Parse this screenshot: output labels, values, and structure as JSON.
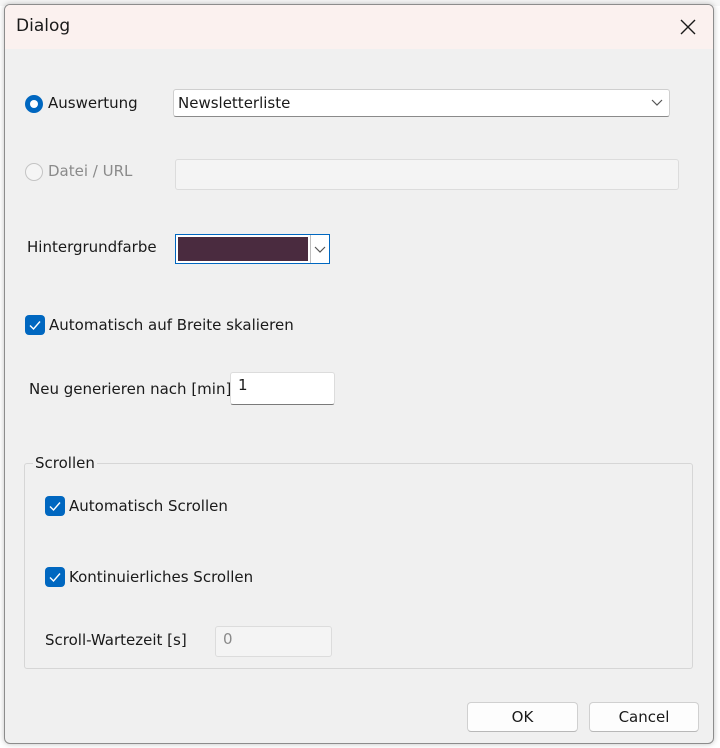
{
  "dialog": {
    "title": "Dialog"
  },
  "source": {
    "evaluation_label": "Auswertung",
    "evaluation_selected": true,
    "evaluation_value": "Newsletterliste",
    "file_label": "Datei / URL",
    "file_selected": false,
    "file_value": ""
  },
  "background": {
    "label": "Hintergrundfarbe",
    "color": "#4a2b3f"
  },
  "scale": {
    "label": "Automatisch auf Breite skalieren",
    "checked": true
  },
  "regenerate": {
    "label": "Neu generieren nach [min]",
    "value": "1"
  },
  "scrolling": {
    "group_title": "Scrollen",
    "auto_label": "Automatisch Scrollen",
    "auto_checked": true,
    "continuous_label": "Kontinuierliches Scrollen",
    "continuous_checked": true,
    "wait_label": "Scroll-Wartezeit [s]",
    "wait_value": "0"
  },
  "buttons": {
    "ok_label": "OK",
    "cancel_label": "Cancel"
  },
  "colors": {
    "accent": "#0067c0",
    "titlebar": "#fbf1ef",
    "dialog_bg": "#f0f0f0"
  }
}
